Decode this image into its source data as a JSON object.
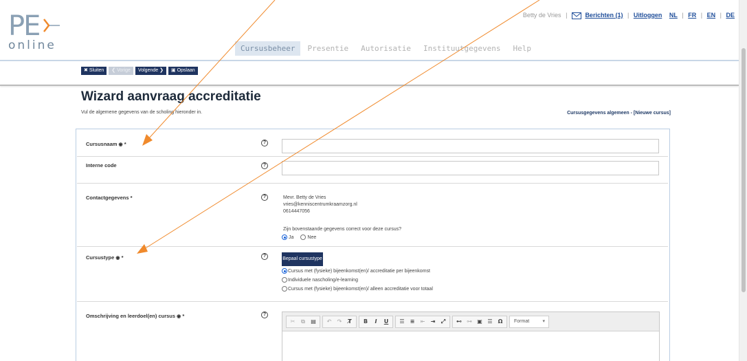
{
  "header": {
    "logo_main": "PE",
    "logo_sub": "online",
    "user_name": "Betty de Vries",
    "messages_link": "Berichten (1)",
    "logout_link": "Uitloggen",
    "languages": [
      "NL",
      "FR",
      "EN",
      "DE"
    ]
  },
  "nav": {
    "items": [
      {
        "label": "Cursusbeheer",
        "active": true
      },
      {
        "label": "Presentie",
        "active": false
      },
      {
        "label": "Autorisatie",
        "active": false
      },
      {
        "label": "Instituutgegevens",
        "active": false
      },
      {
        "label": "Help",
        "active": false
      }
    ]
  },
  "toolbar": {
    "close_icon": "✖",
    "close_label": "Sluiten",
    "prev_label": "❮ Vorige",
    "next_label": "Volgende ❯",
    "save_icon": "💾",
    "save_label": "Opslaan"
  },
  "page": {
    "title": "Wizard aanvraag accreditatie",
    "subtitle": "Vul de algemene gegevens van de scholing hieronder in.",
    "step_label": "Cursusgegevens algemeen - [Nieuwe cursus]"
  },
  "form": {
    "course_name_label": "Cursusnaam",
    "course_name_value": "",
    "internal_code_label": "Interne code",
    "internal_code_value": "",
    "contact_label": "Contactgegevens",
    "contact_name": "Mevr. Betty de Vries",
    "contact_email": "vries@kenniscentrumkraamzorg.nl",
    "contact_phone": "0614447056",
    "contact_question": "Zijn bovenstaande gegevens correct voor deze cursus?",
    "yes_label": "Ja",
    "no_label": "Nee",
    "yes_selected": true,
    "course_type_label": "Cursustype",
    "course_type_button": "Bepaal cursustype",
    "course_type_options": [
      "Cursus met (fysieke) bijeenkomst(en)/ accreditatie per bijeenkomst",
      "Individuele nascholing/e-learning",
      "Cursus met (fysieke) bijeenkomst(en)/ alleen accreditatie voor totaal"
    ],
    "course_type_selected": 0,
    "description_label": "Omschrijving en leerdoel(en) cursus",
    "required_mark": "*",
    "help_glyph": "?",
    "editor_format_label": "Format"
  },
  "colors": {
    "primary": "#1f3460",
    "annotation_arrow": "#f08a2c",
    "link": "#1f4e9a"
  }
}
